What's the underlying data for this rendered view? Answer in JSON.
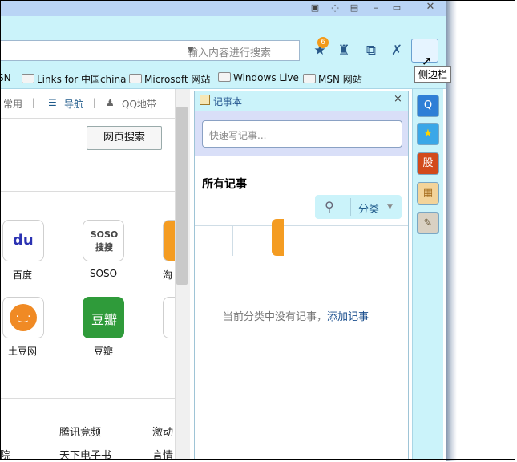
{
  "window": {
    "close_label": "✕"
  },
  "toolbar": {
    "search_placeholder": "输入内容进行搜索",
    "badge_count": "6"
  },
  "favorites": [
    {
      "label": "SN"
    },
    {
      "label": "Links for 中国china"
    },
    {
      "label": "Microsoft 网站"
    },
    {
      "label": "Windows Live"
    },
    {
      "label": "MSN 网站"
    }
  ],
  "tooltip": "侧边栏",
  "page": {
    "nav": [
      {
        "label": "常用"
      },
      {
        "label": "导航"
      },
      {
        "label": "QQ地带"
      }
    ],
    "web_search_button": "网页搜索",
    "apps": [
      {
        "label": "百度",
        "icon_text": "du"
      },
      {
        "label": "SOSO",
        "icon_text": "SOSO 搜搜"
      },
      {
        "label": "土豆网",
        "icon_text": "·‿·"
      },
      {
        "label": "豆瓣",
        "icon_text": "豆瓣"
      }
    ],
    "partial_label": "淘",
    "links": [
      "腾讯竞频",
      "激动",
      "天下电子书",
      "言情",
      "院"
    ]
  },
  "notepad": {
    "title": "记事本",
    "close": "×",
    "input_placeholder": "快速写记事...",
    "all_notes": "所有记事",
    "category": "分类",
    "empty_text": "当前分类中没有记事，",
    "add_link": "添加记事"
  },
  "rail_buttons": [
    {
      "name": "qq-icon",
      "text": "Q"
    },
    {
      "name": "star-icon",
      "text": "★"
    },
    {
      "name": "stock-icon",
      "text": "股"
    },
    {
      "name": "calendar-icon",
      "text": "▦"
    },
    {
      "name": "notebook-icon",
      "text": "✎"
    }
  ],
  "colors": {
    "accent": "#cbf3fa",
    "link": "#1b4f8e",
    "orange": "#f49c22"
  }
}
